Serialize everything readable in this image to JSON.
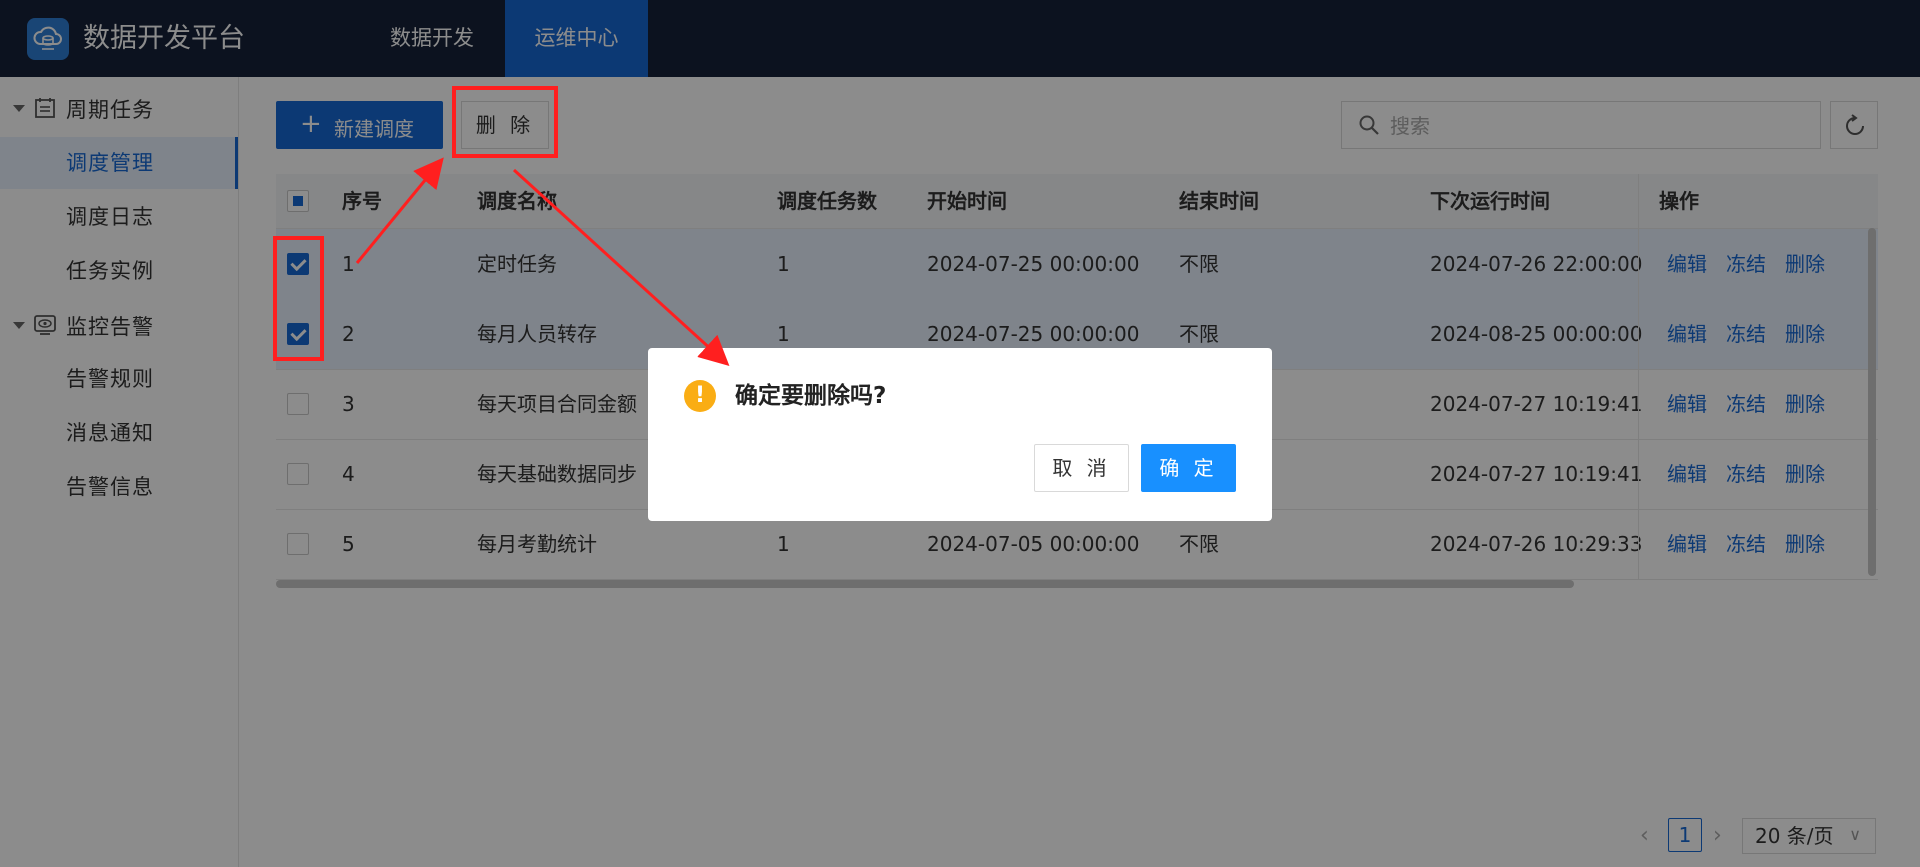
{
  "header": {
    "brand": "数据开发平台",
    "nav": [
      {
        "label": "数据开发",
        "active": false
      },
      {
        "label": "运维中心",
        "active": true
      }
    ]
  },
  "sidebar": {
    "groups": [
      {
        "label": "周期任务",
        "icon": "calendar-list-icon",
        "items": [
          {
            "label": "调度管理",
            "active": true
          },
          {
            "label": "调度日志",
            "active": false
          },
          {
            "label": "任务实例",
            "active": false
          }
        ]
      },
      {
        "label": "监控告警",
        "icon": "monitor-eye-icon",
        "items": [
          {
            "label": "告警规则",
            "active": false
          },
          {
            "label": "消息通知",
            "active": false
          },
          {
            "label": "告警信息",
            "active": false
          }
        ]
      }
    ]
  },
  "toolbar": {
    "new_label": "新建调度",
    "delete_label": "删 除",
    "search_placeholder": "搜索"
  },
  "table": {
    "columns": [
      "序号",
      "调度名称",
      "调度任务数",
      "开始时间",
      "结束时间",
      "下次运行时间",
      "操作"
    ],
    "rows": [
      {
        "no": "1",
        "name": "定时任务",
        "count": "1",
        "start": "2024-07-25 00:00:00",
        "end": "不限",
        "next": "2024-07-26 22:00:00",
        "checked": true
      },
      {
        "no": "2",
        "name": "每月人员转存",
        "count": "1",
        "start": "2024-07-25 00:00:00",
        "end": "不限",
        "next": "2024-08-25 00:00:00",
        "checked": true
      },
      {
        "no": "3",
        "name": "每天项目合同金额",
        "count": "",
        "start": "",
        "end": "",
        "next": "2024-07-27 10:19:41",
        "checked": false
      },
      {
        "no": "4",
        "name": "每天基础数据同步",
        "count": "",
        "start": "",
        "end": "",
        "next": "2024-07-27 10:19:41",
        "checked": false
      },
      {
        "no": "5",
        "name": "每月考勤统计",
        "count": "1",
        "start": "2024-07-05 00:00:00",
        "end": "不限",
        "next": "2024-07-26 10:29:33",
        "checked": false
      }
    ],
    "actions": [
      "编辑",
      "冻结",
      "删除"
    ]
  },
  "pagination": {
    "current": "1",
    "page_size": "20 条/页"
  },
  "dialog": {
    "title": "确定要删除吗?",
    "cancel_label": "取 消",
    "ok_label": "确 定"
  },
  "colors": {
    "primary": "#1769d4",
    "header_bg": "#17223a",
    "warning": "#faad14",
    "annotation": "#ff1f1f"
  }
}
